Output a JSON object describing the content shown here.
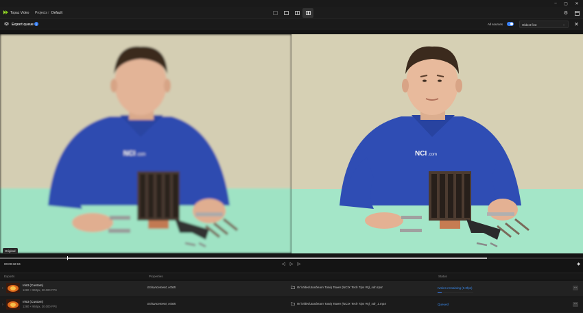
{
  "window": {
    "minimize_icon": "minimize-icon",
    "maximize_icon": "maximize-icon",
    "close_icon": "close-icon"
  },
  "header": {
    "app_name": "Topaz Video",
    "breadcrumb": [
      "Projects",
      "Default"
    ],
    "breadcrumb_separator": "/",
    "view_modes": [
      "single-view",
      "side-by-side-view",
      "split-view",
      "compare-view"
    ],
    "active_view_mode": "compare-view",
    "right_icons": [
      "gear-icon",
      "export-panel-icon"
    ]
  },
  "toolbar": {
    "export_queue_label": "Export queue",
    "export_queue_count": "1",
    "all_sources_label": "All sources",
    "all_sources_enabled": true,
    "sort_value": "Oldest first",
    "accent_color": "#3b82f6"
  },
  "preview": {
    "left_label": "Original",
    "timecode": "00:00:32:04",
    "playhead_fraction": 0.115,
    "inout_end_fraction": 0.835
  },
  "queue": {
    "columns": [
      "Exports",
      "Properties",
      "Status"
    ],
    "rows": [
      {
        "model": "Iris3 (Custom)",
        "spec": "1280 × 960px, 30.000 FPS",
        "properties": "Enhancement, H265",
        "path": "W:\\Video\\Sunbeam Tuniq Tower (NCIX Tech Tips #5)_sdr.mp4",
        "status": "Ivmins remaining (0.0fps)",
        "progress": 0.12
      },
      {
        "model": "Iris3 (Custom)",
        "spec": "1280 × 960px, 30.000 FPS",
        "properties": "Enhancement, H265",
        "path": "W:\\Video\\Sunbeam Tuniq Tower (NCIX Tech Tips #5)_sdr_1.mp4",
        "status": "Queued"
      }
    ]
  }
}
